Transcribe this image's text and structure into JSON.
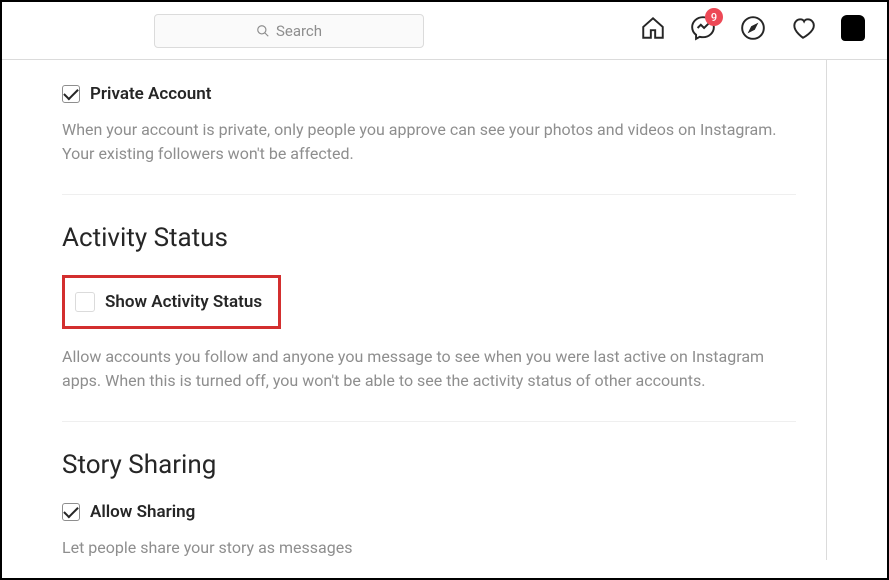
{
  "header": {
    "search_placeholder": "Search",
    "messages_badge": "9"
  },
  "sections": {
    "privacy": {
      "private_account_label": "Private Account",
      "private_account_desc": "When your account is private, only people you approve can see your photos and videos on Instagram. Your existing followers won't be affected."
    },
    "activity": {
      "title": "Activity Status",
      "show_activity_label": "Show Activity Status",
      "show_activity_desc": "Allow accounts you follow and anyone you message to see when you were last active on Instagram apps. When this is turned off, you won't be able to see the activity status of other accounts."
    },
    "story": {
      "title": "Story Sharing",
      "allow_sharing_label": "Allow Sharing",
      "allow_sharing_desc": "Let people share your story as messages"
    }
  }
}
